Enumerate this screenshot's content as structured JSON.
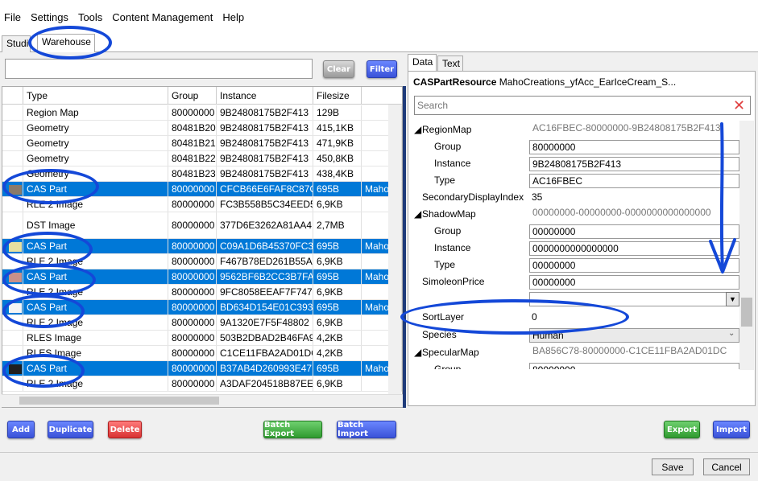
{
  "menu": [
    "File",
    "Settings",
    "Tools",
    "Content Management",
    "Help"
  ],
  "tabs": {
    "studio": "Studio",
    "warehouse": "Warehouse"
  },
  "left_buttons": {
    "clear": "Clear",
    "filter": "Filter"
  },
  "grid": {
    "columns": [
      "Type",
      "Group",
      "Instance",
      "Filesize"
    ],
    "rows": [
      {
        "type": "Region Map",
        "group": "80000000",
        "instance": "9B24808175B2F413",
        "size": "129B",
        "extra": "",
        "selected": false,
        "thumb": ""
      },
      {
        "type": "Geometry",
        "group": "80481B20",
        "instance": "9B24808175B2F413",
        "size": "415,1KB",
        "extra": "",
        "selected": false,
        "thumb": ""
      },
      {
        "type": "Geometry",
        "group": "80481B21",
        "instance": "9B24808175B2F413",
        "size": "471,9KB",
        "extra": "",
        "selected": false,
        "thumb": ""
      },
      {
        "type": "Geometry",
        "group": "80481B22",
        "instance": "9B24808175B2F413",
        "size": "450,8KB",
        "extra": "",
        "selected": false,
        "thumb": ""
      },
      {
        "type": "Geometry",
        "group": "80481B23",
        "instance": "9B24808175B2F413",
        "size": "438,4KB",
        "extra": "",
        "selected": false,
        "thumb": ""
      },
      {
        "type": "CAS Part",
        "group": "80000000",
        "instance": "CFCB66E6FAF8C87C",
        "size": "695B",
        "extra": "Maho",
        "selected": true,
        "thumb": "#8a7a6a"
      },
      {
        "type": "RLE 2 Image",
        "group": "80000000",
        "instance": "FC3B558B5C34EED5",
        "size": "6,9KB",
        "extra": "",
        "selected": false,
        "thumb": ""
      },
      {
        "type": "DST Image",
        "group": "80000000",
        "instance": "377D6E3262A81AA4",
        "size": "2,7MB",
        "extra": "",
        "selected": false,
        "thumb": ""
      },
      {
        "type": "CAS Part",
        "group": "80000000",
        "instance": "C09A1D6B45370FC3",
        "size": "695B",
        "extra": "Maho",
        "selected": true,
        "thumb": "#e8e0a0"
      },
      {
        "type": "RLE 2 Image",
        "group": "80000000",
        "instance": "F467B78ED261B55A",
        "size": "6,9KB",
        "extra": "",
        "selected": false,
        "thumb": ""
      },
      {
        "type": "CAS Part",
        "group": "80000000",
        "instance": "9562BF6B2CC3B7FA",
        "size": "695B",
        "extra": "Maho",
        "selected": true,
        "thumb": "#c8908a"
      },
      {
        "type": "RLE 2 Image",
        "group": "80000000",
        "instance": "9FC8058EEAF7F747",
        "size": "6,9KB",
        "extra": "",
        "selected": false,
        "thumb": ""
      },
      {
        "type": "CAS Part",
        "group": "80000000",
        "instance": "BD634D154E01C393",
        "size": "695B",
        "extra": "Maho",
        "selected": true,
        "thumb": "#f4f4f4"
      },
      {
        "type": "RLE 2 Image",
        "group": "80000000",
        "instance": "9A1320E7F5F48802",
        "size": "6,9KB",
        "extra": "",
        "selected": false,
        "thumb": ""
      },
      {
        "type": "RLES Image",
        "group": "80000000",
        "instance": "503B2DBAD2B46FA9",
        "size": "4,2KB",
        "extra": "",
        "selected": false,
        "thumb": ""
      },
      {
        "type": "RLES Image",
        "group": "80000000",
        "instance": "C1CE11FBA2AD01DC",
        "size": "4,2KB",
        "extra": "",
        "selected": false,
        "thumb": ""
      },
      {
        "type": "CAS Part",
        "group": "80000000",
        "instance": "B37AB4D260993E47",
        "size": "695B",
        "extra": "Maho",
        "selected": true,
        "thumb": "#202020"
      },
      {
        "type": "RLE 2 Image",
        "group": "80000000",
        "instance": "A3DAF204518B87EE",
        "size": "6,9KB",
        "extra": "",
        "selected": false,
        "thumb": ""
      }
    ]
  },
  "right_tabs": {
    "data": "Data",
    "text": "Text"
  },
  "resource": {
    "kind": "CASPartResource",
    "name": "MahoCreations_yfAcc_EarIceCream_S..."
  },
  "search": {
    "placeholder": "Search"
  },
  "props": {
    "region_map": {
      "label": "RegionMap",
      "summary": "AC16FBEC-80000000-9B24808175B2F413"
    },
    "region_group": {
      "label": "Group",
      "value": "80000000"
    },
    "region_instance": {
      "label": "Instance",
      "value": "9B24808175B2F413"
    },
    "region_type": {
      "label": "Type",
      "value": "AC16FBEC"
    },
    "secondary_display_index": {
      "label": "SecondaryDisplayIndex",
      "value": "35"
    },
    "shadow_map": {
      "label": "ShadowMap",
      "summary": "00000000-00000000-0000000000000000"
    },
    "shadow_group": {
      "label": "Group",
      "value": "00000000"
    },
    "shadow_instance": {
      "label": "Instance",
      "value": "0000000000000000"
    },
    "shadow_type": {
      "label": "Type",
      "value": "00000000"
    },
    "simoleon_price": {
      "label": "SimoleonPrice",
      "value": "00000000"
    },
    "sort_layer": {
      "label": "SortLayer",
      "value": "0"
    },
    "species": {
      "label": "Species",
      "value": "Human"
    },
    "specular_map": {
      "label": "SpecularMap",
      "summary": "BA856C78-80000000-C1CE11FBA2AD01DC"
    },
    "specular_group": {
      "label": "Group",
      "value": "80000000"
    }
  },
  "bottom_buttons": {
    "add": "Add",
    "duplicate": "Duplicate",
    "delete": "Delete",
    "batch_export": "Batch Export",
    "batch_import": "Batch Import",
    "export": "Export",
    "import": "Import"
  },
  "dialog_buttons": {
    "save": "Save",
    "cancel": "Cancel"
  },
  "colors": {
    "selection": "#0078d7",
    "annotation": "#1448d8",
    "splitter": "#1f3b7a"
  }
}
